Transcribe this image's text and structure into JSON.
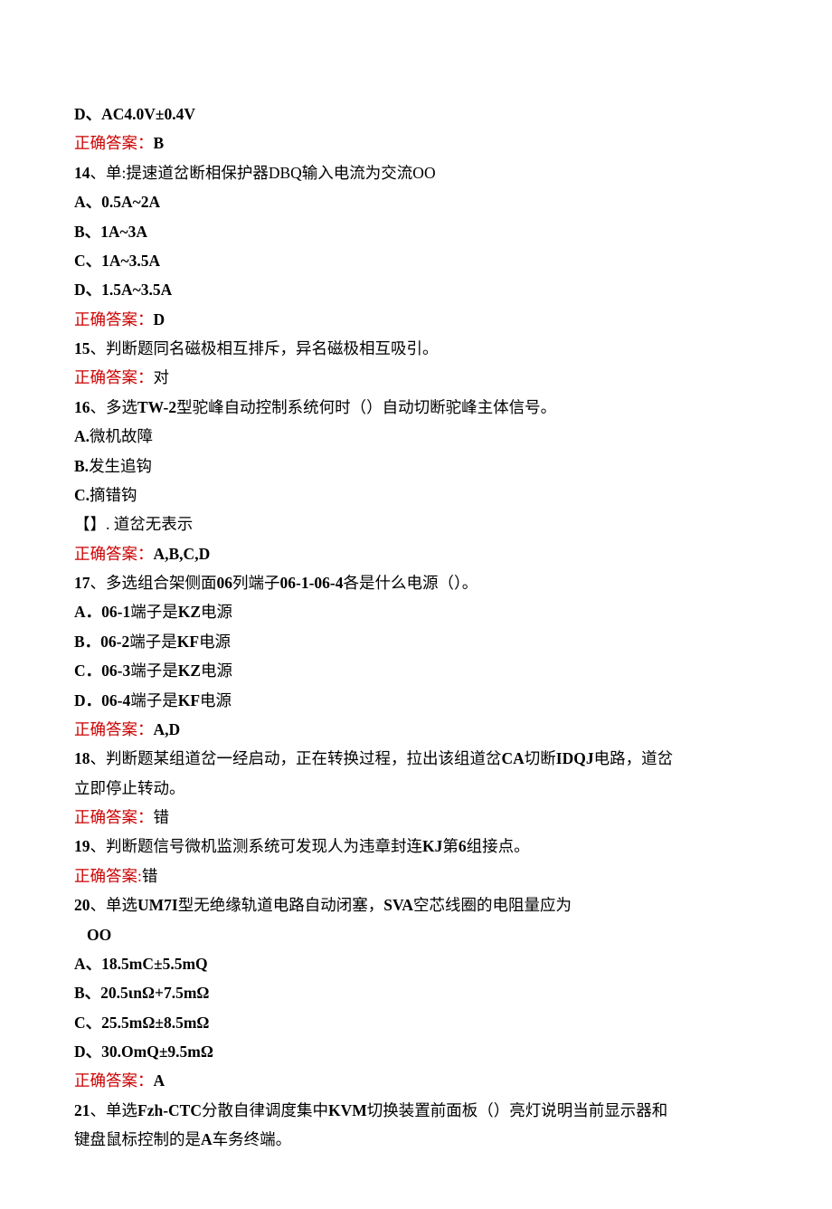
{
  "q13": {
    "optD": "D、AC4.0V±0.4V",
    "ansLabel": "正确答案：",
    "ansVal": "B"
  },
  "q14": {
    "stem": "、单:提速道岔断相保护器DBQ输入电流为交流OO",
    "num": "14",
    "a": "A、0.5A~2A",
    "b": "B、1A~3A",
    "c": "C、1A~3.5A",
    "d": "D、1.5A~3.5A",
    "ansLabel": "正确答案：",
    "ansVal": "D"
  },
  "q15": {
    "num": "15",
    "stem": "、判断题同名磁极相互排斥，异名磁极相互吸引。",
    "ansLabel": "正确答案：",
    "ansVal": "对"
  },
  "q16": {
    "num": "16",
    "stemPre": "、多选",
    "stemBold": "TW-2",
    "stemPost": "型驼峰自动控制系统何时（）自动切断驼峰主体信号。",
    "a": "A.",
    "aText": "微机故障",
    "b": "B.",
    "bText": "发生追钩",
    "c": "C.",
    "cText": "摘错钩",
    "dPre": "【】. 道岔无表示",
    "ansLabel": "正确答案：",
    "ansVal": "A,B,C,D"
  },
  "q17": {
    "num": "17",
    "stemPre": "、多选组合架侧面",
    "stemMid1": "06",
    "stemPost1": "列端子",
    "stemMid2": "06-1-06-4",
    "stemPost2": "各是什么电源（）。",
    "a": "A．06-1",
    "aMid": "端子是",
    "aEnd": "KZ",
    "aTail": "电源",
    "b": "B．06-2",
    "bMid": "端子是",
    "bEnd": "KF",
    "bTail": "电源",
    "c": "C．06-3",
    "cMid": "端子是",
    "cEnd": "KZ",
    "cTail": "电源",
    "d": "D．06-4",
    "dMid": "端子是",
    "dEnd": "KF",
    "dTail": "电源",
    "ansLabel": "正确答案：",
    "ansVal": "A,D"
  },
  "q18": {
    "num": "18",
    "stem1": "、判断题某组道岔一经启动，正在转换过程，拉出该组道岔",
    "ca": "CA",
    "mid": "切断",
    "idqj": "IDQJ",
    "tail": "电路，道岔",
    "line2": "立即停止转动。",
    "ansLabel": "正确答案：",
    "ansVal": "错"
  },
  "q19": {
    "num": "19",
    "stem1": "、判断题信号微机监测系统可发现人为违章封连",
    "kj": "KJ",
    "mid": "第",
    "six": "6",
    "tail": "组接点。",
    "ansLabel": "正确答案:",
    "ansVal": "错"
  },
  "q20": {
    "num": "20",
    "stemPre": "、单选",
    "um": "UM7I",
    "mid": "型无绝缘轨道电路自动闭塞，",
    "sva": "SVA",
    "tail": "空芯线圈的电阻量应为",
    "oo": "OO",
    "a": "A、18.5mC±5.5mQ",
    "b": "B、20.5ιnΩ+7.5mΩ",
    "c": "C、25.5mΩ±8.5mΩ",
    "d": "D、30.OmQ±9.5mΩ",
    "ansLabel": "正确答案：",
    "ansVal": "A"
  },
  "q21": {
    "num": "21",
    "stemPre": "、单选",
    "fzh": "Fzh-CTC",
    "mid1": "分散自律调度集中",
    "kvm": "KVM",
    "mid2": "切换装置前面板（）亮灯说明当前显示器和",
    "line2a": "键盘鼠标控制的是",
    "a": "A",
    "line2b": "车务终端。"
  }
}
